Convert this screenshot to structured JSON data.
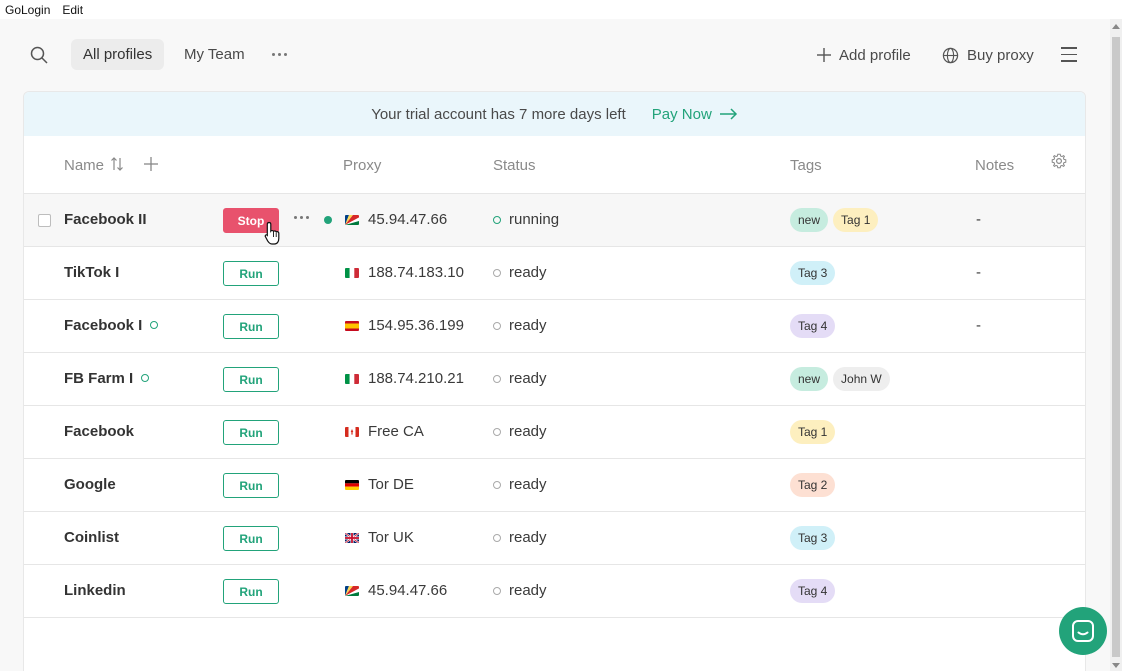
{
  "menubar": {
    "items": [
      "GoLogin",
      "Edit"
    ]
  },
  "topbar": {
    "tabs": [
      {
        "label": "All profiles",
        "active": true
      },
      {
        "label": "My Team",
        "active": false
      }
    ],
    "add_profile": "Add profile",
    "buy_proxy": "Buy proxy"
  },
  "banner": {
    "text": "Your trial account has 7 more days left",
    "pay_label": "Pay Now"
  },
  "table": {
    "headers": {
      "name": "Name",
      "proxy": "Proxy",
      "status": "Status",
      "tags": "Tags",
      "notes": "Notes"
    },
    "rows": [
      {
        "name": "Facebook II",
        "action": "Stop",
        "proxy": "45.94.47.66",
        "flag": "sc",
        "status": "running",
        "tags": [
          {
            "label": "new",
            "color": "#c6ecdf"
          },
          {
            "label": "Tag 1",
            "color": "#fdefbf"
          }
        ],
        "notes": "-"
      },
      {
        "name": "TikTok I",
        "action": "Run",
        "proxy": "188.74.183.10",
        "flag": "it",
        "status": "ready",
        "tags": [
          {
            "label": "Tag 3",
            "color": "#d0f0f8"
          }
        ],
        "notes": "-"
      },
      {
        "name": "Facebook I",
        "action": "Run",
        "proxy": "154.95.36.199",
        "flag": "es",
        "status": "ready",
        "tags": [
          {
            "label": "Tag 4",
            "color": "#e4dcf6"
          }
        ],
        "notes": "-"
      },
      {
        "name": "FB Farm I",
        "action": "Run",
        "proxy": "188.74.210.21",
        "flag": "it",
        "status": "ready",
        "tags": [
          {
            "label": "new",
            "color": "#c6ecdf"
          },
          {
            "label": "John W",
            "color": "#eeeeee"
          }
        ],
        "notes": ""
      },
      {
        "name": "Facebook",
        "action": "Run",
        "proxy": "Free CA",
        "flag": "ca",
        "status": "ready",
        "tags": [
          {
            "label": "Tag 1",
            "color": "#fdefbf"
          }
        ],
        "notes": ""
      },
      {
        "name": "Google",
        "action": "Run",
        "proxy": "Tor DE",
        "flag": "de",
        "status": "ready",
        "tags": [
          {
            "label": "Tag 2",
            "color": "#fde0d3"
          }
        ],
        "notes": ""
      },
      {
        "name": "Coinlist",
        "action": "Run",
        "proxy": "Tor UK",
        "flag": "gb",
        "status": "ready",
        "tags": [
          {
            "label": "Tag 3",
            "color": "#d0f0f8"
          }
        ],
        "notes": ""
      },
      {
        "name": "Linkedin",
        "action": "Run",
        "proxy": "45.94.47.66",
        "flag": "sc",
        "status": "ready",
        "tags": [
          {
            "label": "Tag 4",
            "color": "#e4dcf6"
          }
        ],
        "notes": ""
      }
    ]
  },
  "colors": {
    "accent": "#22a37a",
    "stop": "#e8526d",
    "banner_bg": "#eaf6fb"
  }
}
